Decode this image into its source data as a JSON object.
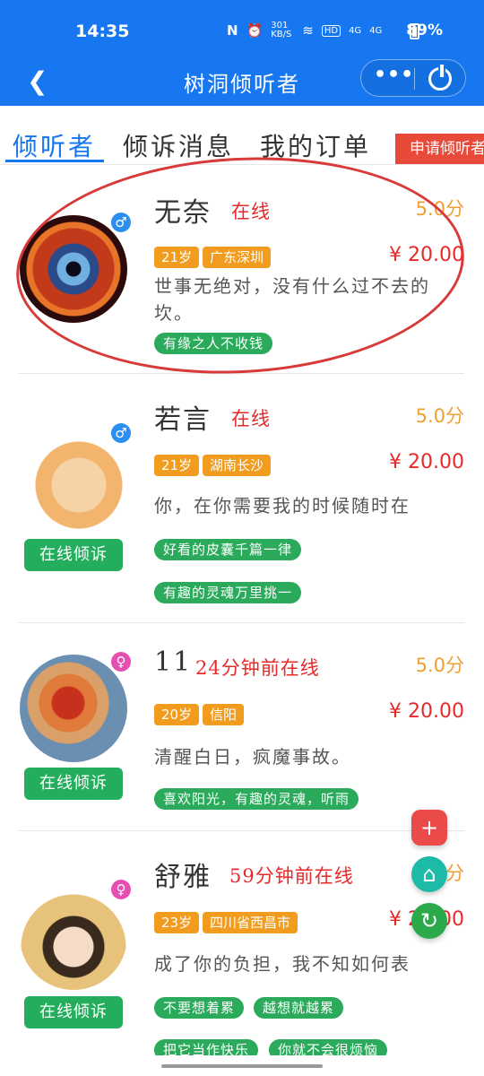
{
  "status_bar": {
    "time": "14:35",
    "icons": [
      "nfc-icon",
      "alarm-icon",
      "net-speed-icon",
      "wifi-icon",
      "hd-icon",
      "signal-icon",
      "signal-icon"
    ],
    "net_speed": "301 KB/S",
    "hd": "HD",
    "signal1": "4G",
    "signal2": "4G",
    "battery": "89%"
  },
  "navbar": {
    "title": "树洞倾听者",
    "more": "•••"
  },
  "tabs": [
    {
      "label": "倾听者",
      "active": true
    },
    {
      "label": "倾诉消息",
      "active": false
    },
    {
      "label": "我的订单",
      "active": false
    }
  ],
  "apply_button": "申请倾听者",
  "listeners": [
    {
      "name": "无奈",
      "status": "在线",
      "score": "5.0分",
      "gender": "male",
      "gender_symbol": "♂",
      "age": "21岁",
      "location": "广东深圳",
      "price": "¥ 20.00",
      "desc": "世事无绝对，没有什么过不去的坎。",
      "tags": [
        "有缘之人不收钱"
      ]
    },
    {
      "name": "若言",
      "status": "在线",
      "score": "5.0分",
      "gender": "male",
      "gender_symbol": "♂",
      "age": "21岁",
      "location": "湖南长沙",
      "price": "¥ 20.00",
      "desc": "你，在你需要我的时候随时在",
      "button": "在线倾诉",
      "tags": [
        "好看的皮囊千篇一律",
        "有趣的灵魂万里挑一"
      ]
    },
    {
      "name": "11",
      "status": "24分钟前在线",
      "score": "5.0分",
      "gender": "female",
      "gender_symbol": "♀",
      "age": "20岁",
      "location": "信阳",
      "price": "¥ 20.00",
      "desc": "清醒白日，疯魔事故。",
      "button": "在线倾诉",
      "tags": [
        "喜欢阳光，有趣的灵魂，听雨"
      ]
    },
    {
      "name": "舒雅",
      "status": "59分钟前在线",
      "score": "5.0分",
      "gender": "female",
      "gender_symbol": "♀",
      "age": "23岁",
      "location": "四川省西昌市",
      "price": "¥ 20.00",
      "desc": "成了你的负担，我不知如何表",
      "button": "在线倾诉",
      "tags": [
        "不要想着累",
        "越想就越累",
        "把它当作快乐",
        "你就不会很烦恼"
      ]
    }
  ],
  "fabs": {
    "add": "+",
    "home": "⌂",
    "refresh": "↻"
  },
  "colors": {
    "primary": "#1677f0",
    "accent_red": "#e62a2a",
    "orange": "#f29c1f",
    "green": "#2aaa5a",
    "score": "#f0a030"
  }
}
